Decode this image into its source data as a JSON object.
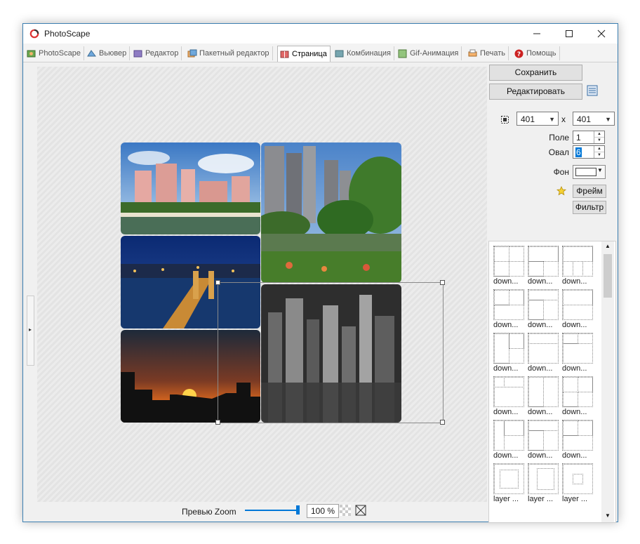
{
  "window": {
    "title": "PhotoScape"
  },
  "tabs": [
    {
      "label": "PhotoScape",
      "icon": "photoscape-icon"
    },
    {
      "label": "Вьювер",
      "icon": "viewer-icon"
    },
    {
      "label": "Редактор",
      "icon": "editor-icon"
    },
    {
      "label": "Пакетный редактор",
      "icon": "batch-editor-icon"
    },
    {
      "label": "Страница",
      "icon": "page-icon",
      "active": true
    },
    {
      "label": "Комбинация",
      "icon": "combine-icon"
    },
    {
      "label": "Gif-Анимация",
      "icon": "gif-icon"
    },
    {
      "label": "Печать",
      "icon": "print-icon"
    },
    {
      "label": "Помощь",
      "icon": "help-icon"
    }
  ],
  "panel": {
    "save_label": "Сохранить",
    "edit_label": "Редактировать",
    "width_value": "401",
    "size_separator": "x",
    "height_value": "401",
    "margin_label": "Поле",
    "margin_value": "1",
    "oval_label": "Овал",
    "oval_value": "6",
    "background_label": "Фон",
    "background_color": "#ffffff",
    "frame_label": "Фрейм",
    "filter_label": "Фильтр"
  },
  "layouts": [
    "down...",
    "down...",
    "down...",
    "down...",
    "down...",
    "down...",
    "down...",
    "down...",
    "down...",
    "down...",
    "down...",
    "down...",
    "down...",
    "down...",
    "down...",
    "layer ...",
    "layer ...",
    "layer ..."
  ],
  "zoom": {
    "label": "Превью Zoom",
    "value": "100 %",
    "level": 1.0
  },
  "colors": {
    "accent": "#0078d7",
    "window_border": "#3c7fb1"
  }
}
